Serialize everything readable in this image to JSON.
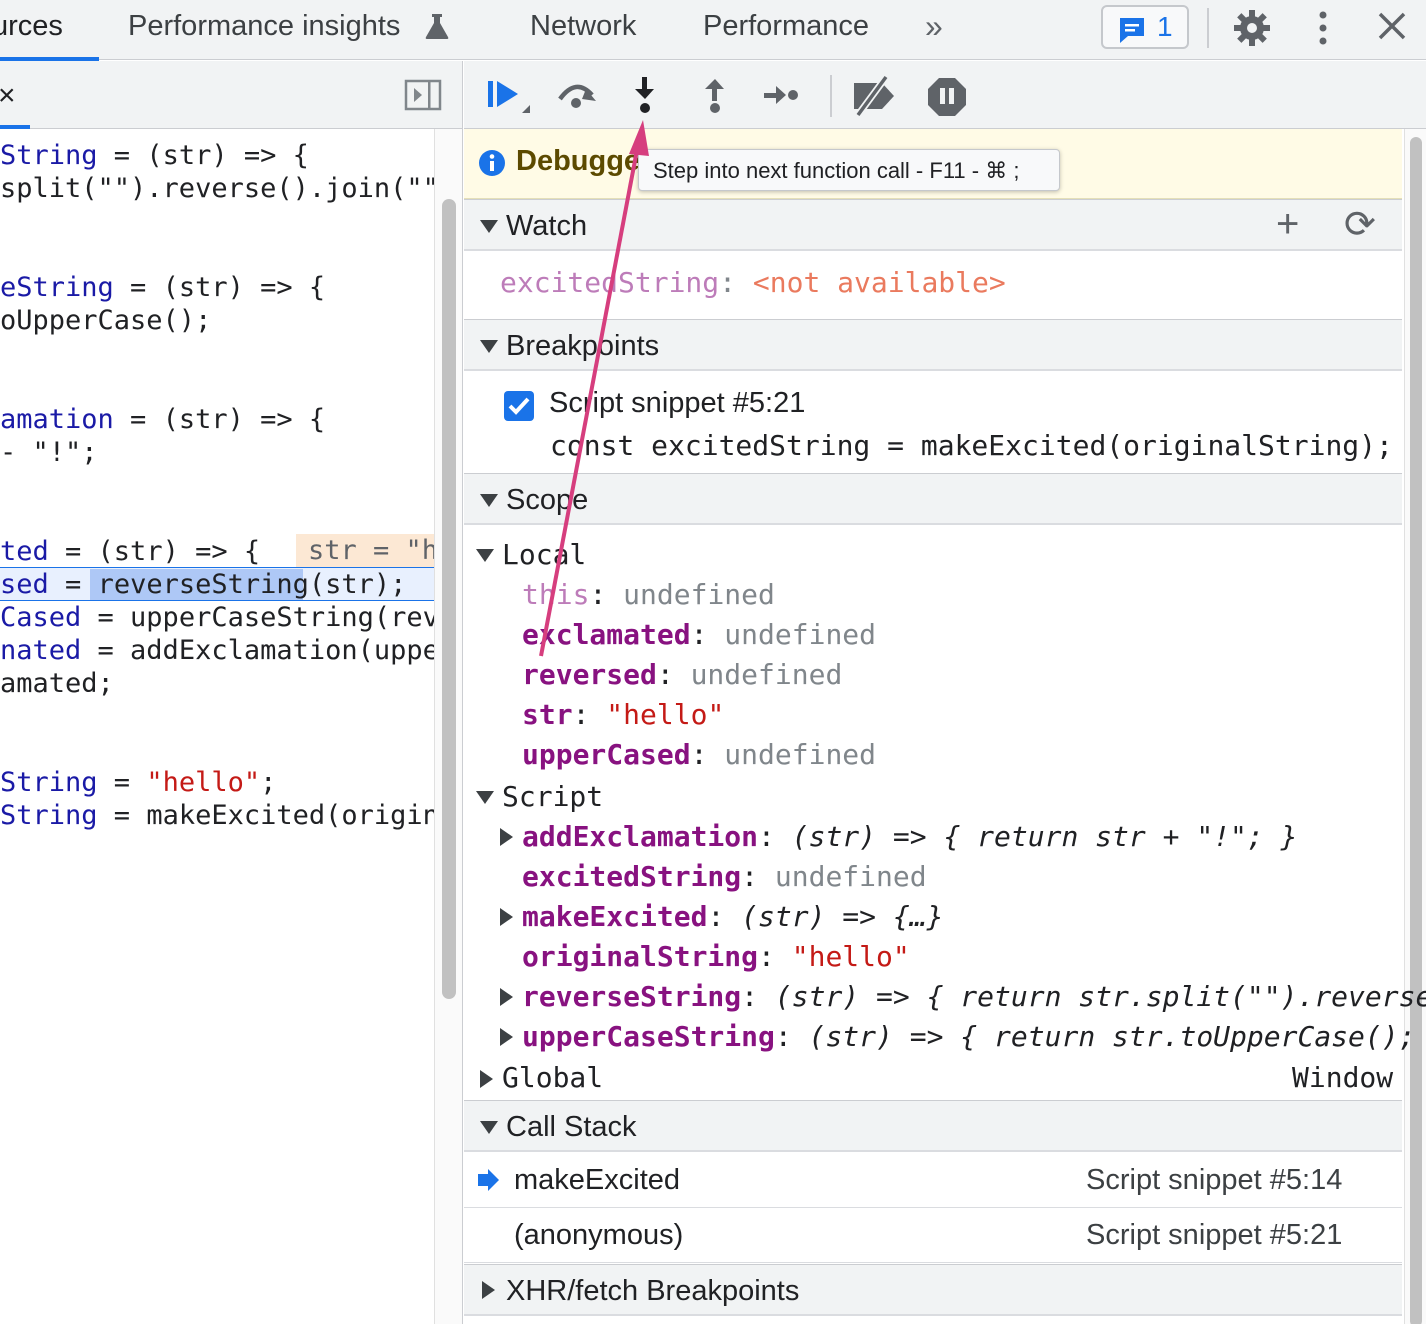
{
  "tabs": {
    "sources": "urces",
    "performance_insights": "Performance insights",
    "network": "Network",
    "performance": "Performance",
    "more": "»",
    "issues_count": "1"
  },
  "colors": {
    "accent": "#1a73e8",
    "annotation_arrow": "#d63e7e",
    "paused_banner_bg": "#fffbe6",
    "paused_line_bg": "#e8f0fe"
  },
  "icons": [
    "flask-icon",
    "issues-icon",
    "gear-icon",
    "kebab-icon",
    "close-icon",
    "toggle-panel-icon",
    "resume-icon",
    "step-over-icon",
    "step-into-icon",
    "step-out-icon",
    "step-icon",
    "deactivate-breakpoints-icon",
    "pause-on-exceptions-icon",
    "info-icon",
    "plus-icon",
    "refresh-icon",
    "checkbox-icon",
    "current-frame-icon"
  ],
  "editor": {
    "close_label": "×",
    "inline_value": "str = \"h",
    "lines": [
      {
        "a": "String",
        "b": " = (str) => {"
      },
      {
        "a": "",
        "b": "split(\"\").reverse().join(\"\""
      },
      {
        "a": "eString",
        "b": " = (str) => {"
      },
      {
        "a": "",
        "b": "oUpperCase();"
      },
      {
        "a": "amation",
        "b": " = (str) => {"
      },
      {
        "a": "",
        "b": "- \"!\";"
      },
      {
        "a": "ted",
        "b": " = (str) => {"
      },
      {
        "a": "sed",
        "b": " = "
      },
      {
        "a": "Cased",
        "b": " = upperCaseString(rev"
      },
      {
        "a": "nated",
        "b": " = addExclamation(uppe"
      },
      {
        "a": "",
        "b": "amated;"
      },
      {
        "a": "String",
        "b": " = "
      },
      {
        "a": "String",
        "b": " = makeExcited(origin"
      }
    ],
    "paused_token": "reverseString",
    "paused_rest": "(str);",
    "hello_literal": "\"hello\"",
    "hello_tail": ";"
  },
  "banner": {
    "paused_text": "Debugge",
    "tooltip": "Step into next function call - F11 - ⌘ ;"
  },
  "watch": {
    "title": "Watch",
    "add": "+",
    "refresh": "⟳",
    "name": "excitedString",
    "value": "<not available>"
  },
  "breakpoints": {
    "title": "Breakpoints",
    "label": "Script snippet #5:21",
    "code": "const excitedString = makeExcited(originalString);",
    "checked": true
  },
  "scope": {
    "title": "Scope",
    "local": {
      "label": "Local",
      "this_name": "this",
      "this_value": "undefined",
      "items": [
        {
          "name": "exclamated",
          "value": "undefined",
          "kind": "undef"
        },
        {
          "name": "reversed",
          "value": "undefined",
          "kind": "undef"
        },
        {
          "name": "str",
          "value": "\"hello\"",
          "kind": "str"
        },
        {
          "name": "upperCased",
          "value": "undefined",
          "kind": "undef"
        }
      ]
    },
    "script": {
      "label": "Script",
      "items": [
        {
          "name": "addExclamation",
          "value": "(str) => { return str + \"!\"; }",
          "kind": "func",
          "expandable": true
        },
        {
          "name": "excitedString",
          "value": "undefined",
          "kind": "undef",
          "expandable": false
        },
        {
          "name": "makeExcited",
          "value": "(str) => {…}",
          "kind": "func",
          "expandable": true
        },
        {
          "name": "originalString",
          "value": "\"hello\"",
          "kind": "str",
          "expandable": false
        },
        {
          "name": "reverseString",
          "value": "(str) => { return str.split(\"\").reverse",
          "kind": "func",
          "expandable": true
        },
        {
          "name": "upperCaseString",
          "value": "(str) => { return str.toUpperCase();",
          "kind": "func",
          "expandable": true
        }
      ]
    },
    "global": {
      "label": "Global",
      "value": "Window"
    }
  },
  "call_stack": {
    "title": "Call Stack",
    "frames": [
      {
        "fn": "makeExcited",
        "loc": "Script snippet #5:14"
      },
      {
        "fn": "(anonymous)",
        "loc": "Script snippet #5:21"
      }
    ]
  },
  "xhr": {
    "title": "XHR/fetch Breakpoints"
  }
}
